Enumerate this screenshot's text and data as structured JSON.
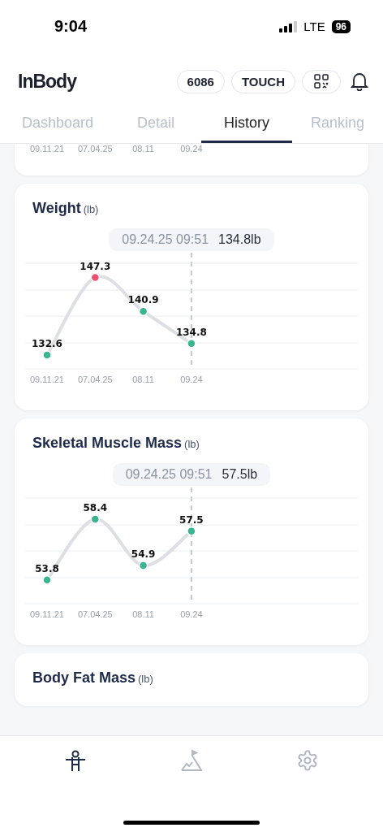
{
  "status_bar": {
    "time": "9:04",
    "network": "LTE",
    "battery": "96"
  },
  "header": {
    "logo": "InBody",
    "buttons": [
      {
        "kind": "text",
        "label": "6086"
      },
      {
        "kind": "text",
        "label": "TOUCH"
      },
      {
        "kind": "qr"
      }
    ]
  },
  "tabs": [
    {
      "label": "Dashboard",
      "selected": false
    },
    {
      "label": "Detail",
      "selected": false
    },
    {
      "label": "History",
      "selected": true
    },
    {
      "label": "Ranking",
      "selected": false
    }
  ],
  "partial_card": {
    "x_labels": [
      "09.11.21",
      "07.04.25",
      "08.11",
      "09.24"
    ]
  },
  "cards": [
    {
      "title": "Weight",
      "unit": "(lb)",
      "tooltip": {
        "date": "09.24.25 09:51",
        "value": "134.8lb"
      },
      "points": [
        {
          "color": "#3bb58f"
        },
        {
          "color": "#f0506e"
        },
        {
          "color": "#3bb58f"
        },
        {
          "color": "#3bb58f"
        }
      ],
      "chart_data": {
        "type": "line",
        "categories": [
          "09.11.21",
          "07.04.25",
          "08.11",
          "09.24"
        ],
        "series": [
          {
            "color": "#dcdfe4",
            "marker": "circle",
            "values": [
              132.6,
              147.3,
              140.9,
              134.8
            ]
          }
        ],
        "ylim": [
          130,
          150
        ],
        "data_labels": true
      }
    },
    {
      "title": "Skeletal Muscle Mass",
      "unit": "(lb)",
      "tooltip": {
        "date": "09.24.25 09:51",
        "value": "57.5lb"
      },
      "points": [
        {
          "color": "#3bb58f"
        },
        {
          "color": "#3bb58f"
        },
        {
          "color": "#3bb58f"
        },
        {
          "color": "#3bb58f"
        }
      ],
      "chart_data": {
        "type": "line",
        "categories": [
          "09.11.21",
          "07.04.25",
          "08.11",
          "09.24"
        ],
        "series": [
          {
            "color": "#dcdfe4",
            "marker": "circle",
            "values": [
              53.8,
              58.4,
              54.9,
              57.5
            ]
          }
        ],
        "ylim": [
          52,
          60
        ],
        "data_labels": true
      }
    },
    {
      "title": "Body Fat Mass",
      "unit": "(lb)"
    }
  ],
  "nav": [
    {
      "kind": "body",
      "selected": true
    },
    {
      "kind": "goal",
      "selected": false
    },
    {
      "kind": "settings",
      "selected": false
    }
  ]
}
